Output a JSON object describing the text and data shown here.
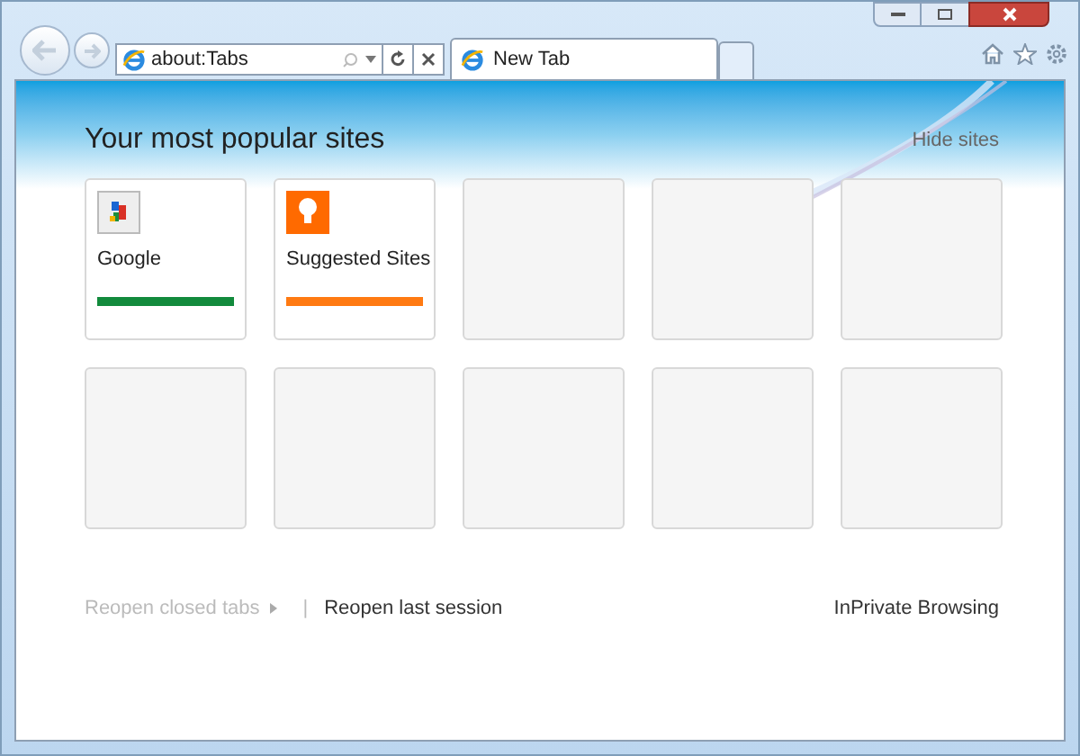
{
  "address_bar": {
    "value": "about:Tabs"
  },
  "tabs": [
    {
      "label": "New Tab",
      "selected": true
    }
  ],
  "heading": "Your most popular sites",
  "hide_sites": "Hide sites",
  "tiles": [
    {
      "kind": "site",
      "label": "Google",
      "color": "#128a3c"
    },
    {
      "kind": "site",
      "label": "Suggested Sites",
      "color": "#ff7a12"
    },
    {
      "kind": "empty"
    },
    {
      "kind": "empty"
    },
    {
      "kind": "empty"
    },
    {
      "kind": "empty"
    },
    {
      "kind": "empty"
    },
    {
      "kind": "empty"
    },
    {
      "kind": "empty"
    },
    {
      "kind": "empty"
    }
  ],
  "footer": {
    "reopen_closed_tabs": {
      "label": "Reopen closed tabs",
      "disabled": true
    },
    "separator": "|",
    "reopen_last_session": "Reopen last session",
    "inprivate": "InPrivate Browsing"
  }
}
